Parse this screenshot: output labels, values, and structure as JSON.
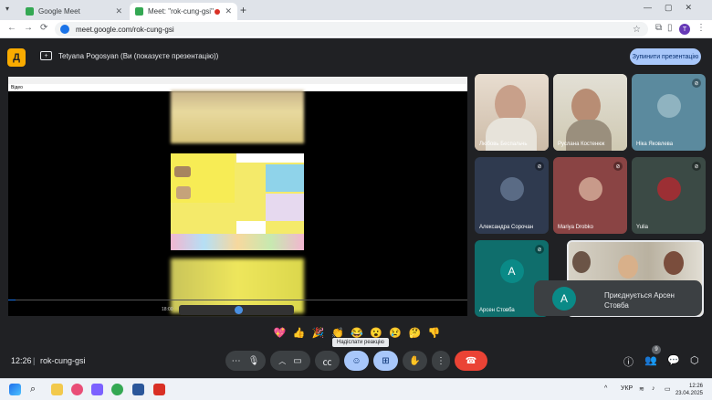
{
  "browser": {
    "tabs": [
      {
        "title": "Google Meet",
        "active": false
      },
      {
        "title": "Meet: \"rok-cung-gsi\"",
        "active": true
      }
    ],
    "url": "meet.google.com/rok-cung-gsi",
    "profile_initial": "T"
  },
  "presentation": {
    "logo_glyph": "Д",
    "title": "Tetyana Pogosyan (Ви (показуєте презентацію))",
    "stop_button": "Зупинити презентацію"
  },
  "viewer": {
    "toolbar_label": "Відео",
    "time": "18:00"
  },
  "participants": [
    {
      "name": "Любовь Беспальчь",
      "muted": false,
      "kind": "video",
      "bg": "#d9c9b5"
    },
    {
      "name": "Руслана Костенюк",
      "muted": false,
      "kind": "video",
      "bg": "#d7d2bf"
    },
    {
      "name": "Ніка Яковлева",
      "muted": true,
      "kind": "avatar",
      "bg": "#5b8a9e"
    },
    {
      "name": "Александра Сорочан",
      "muted": true,
      "kind": "avatar",
      "bg": "#2f3a4f"
    },
    {
      "name": "Mariya Drobko",
      "muted": true,
      "kind": "avatar",
      "bg": "#8a4444"
    },
    {
      "name": "Yulia",
      "muted": true,
      "kind": "avatar",
      "bg": "#3b4a45"
    },
    {
      "name": "Арсен Стовба",
      "muted": true,
      "kind": "letter",
      "letter": "A",
      "bg": "#0f6e6c"
    }
  ],
  "toast": {
    "letter": "A",
    "message": "Приєднується Арсен Стовба"
  },
  "reactions": {
    "emojis": [
      "💖",
      "👍",
      "🎉",
      "👏",
      "😂",
      "😮",
      "😢",
      "🤔",
      "👎"
    ],
    "tooltip": "Надіслати реакцію"
  },
  "bottom": {
    "time": "12:26",
    "separator": "|",
    "meeting_code": "rok-cung-gsi",
    "participant_count": "9",
    "end_call_color": "#ea4335",
    "accent": "#a8c7fa"
  },
  "taskbar": {
    "language": "УКР",
    "time": "12:26",
    "date": "23.04.2025"
  }
}
